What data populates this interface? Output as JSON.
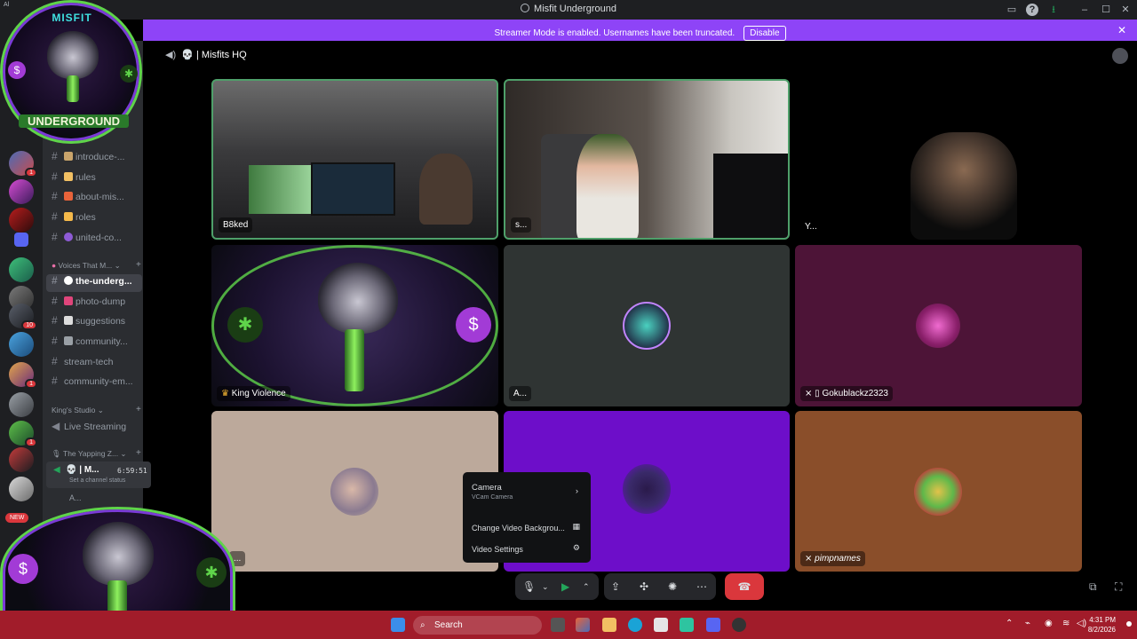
{
  "window": {
    "title": "Misfit Underground",
    "corner_label": "Al"
  },
  "banner": {
    "message": "Streamer Mode is enabled. Usernames have been truncated.",
    "button": "Disable"
  },
  "voice": {
    "channel_title": "Misfits HQ"
  },
  "servers": {
    "badges": [
      "1",
      "1",
      "10",
      "1",
      "1"
    ],
    "new_label": "NEW"
  },
  "channels": {
    "items": [
      {
        "label": "introduce-..."
      },
      {
        "label": "rules"
      },
      {
        "label": "about-mis..."
      },
      {
        "label": "roles"
      },
      {
        "label": "united-co..."
      }
    ],
    "category_voices": "Voices That M...",
    "items2": [
      {
        "label": "the-underg..."
      },
      {
        "label": "photo-dump"
      },
      {
        "label": "suggestions"
      },
      {
        "label": "community..."
      },
      {
        "label": "stream-tech"
      },
      {
        "label": "community-em..."
      }
    ],
    "category_king": "King's Studio",
    "live_streaming": "Live Streaming",
    "category_yapping": "The Yapping Z...",
    "voice_user": "M...",
    "timer": "6:59:51",
    "status_placeholder": "Set a channel status",
    "sub_user": "A..."
  },
  "tiles": [
    {
      "name": "B8ked",
      "bg": "#3a3a3c"
    },
    {
      "name": "s...",
      "bg": "#4a4440"
    },
    {
      "name": "Y...",
      "bg": "#000000"
    },
    {
      "name": "King Violence",
      "bg": "#1c1230"
    },
    {
      "name": "A...",
      "bg": "#2f3433"
    },
    {
      "name": "Gokublackz2323",
      "bg": "#4d1437"
    },
    {
      "name": "...",
      "bg": "#bca99b"
    },
    {
      "name": "",
      "bg": "#6d0ec9"
    },
    {
      "name": "pimpnames",
      "bg": "#8a4e2a"
    }
  ],
  "context_menu": {
    "camera_label": "Camera",
    "camera_sub": "VCam Camera",
    "change_bg": "Change Video Backgrou...",
    "video_settings": "Video Settings"
  },
  "taskbar": {
    "search": "Search",
    "time": "4:31 PM",
    "date": "8/2/2026"
  },
  "logo": {
    "text_top": "MISFIT",
    "text_bottom": "UNDERGROUND"
  },
  "colors": {
    "banner": "#8e44f7",
    "end_call": "#da373c",
    "taskbar": "#a11c2a"
  }
}
